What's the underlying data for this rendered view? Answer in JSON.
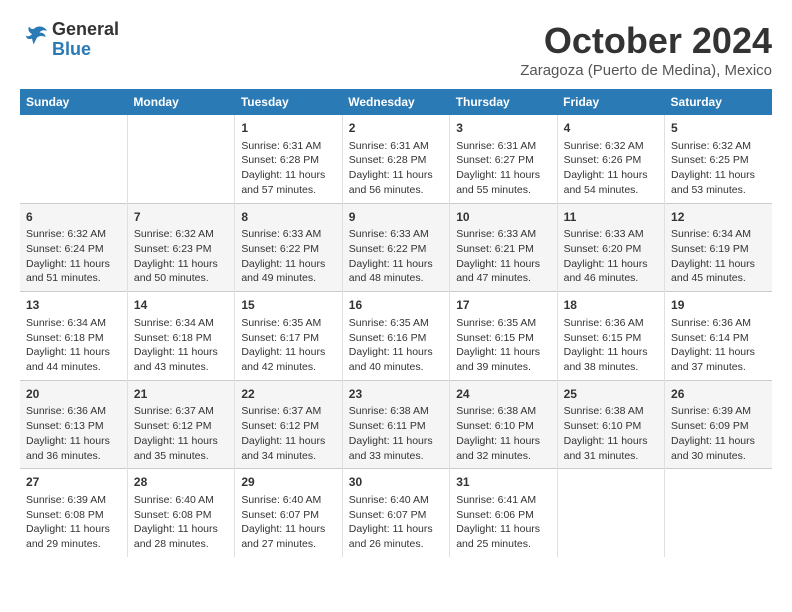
{
  "logo": {
    "line1": "General",
    "line2": "Blue"
  },
  "header": {
    "month_title": "October 2024",
    "location": "Zaragoza (Puerto de Medina), Mexico"
  },
  "days_of_week": [
    "Sunday",
    "Monday",
    "Tuesday",
    "Wednesday",
    "Thursday",
    "Friday",
    "Saturday"
  ],
  "weeks": [
    [
      {
        "day": "",
        "content": ""
      },
      {
        "day": "",
        "content": ""
      },
      {
        "day": "1",
        "content": "Sunrise: 6:31 AM\nSunset: 6:28 PM\nDaylight: 11 hours and 57 minutes."
      },
      {
        "day": "2",
        "content": "Sunrise: 6:31 AM\nSunset: 6:28 PM\nDaylight: 11 hours and 56 minutes."
      },
      {
        "day": "3",
        "content": "Sunrise: 6:31 AM\nSunset: 6:27 PM\nDaylight: 11 hours and 55 minutes."
      },
      {
        "day": "4",
        "content": "Sunrise: 6:32 AM\nSunset: 6:26 PM\nDaylight: 11 hours and 54 minutes."
      },
      {
        "day": "5",
        "content": "Sunrise: 6:32 AM\nSunset: 6:25 PM\nDaylight: 11 hours and 53 minutes."
      }
    ],
    [
      {
        "day": "6",
        "content": "Sunrise: 6:32 AM\nSunset: 6:24 PM\nDaylight: 11 hours and 51 minutes."
      },
      {
        "day": "7",
        "content": "Sunrise: 6:32 AM\nSunset: 6:23 PM\nDaylight: 11 hours and 50 minutes."
      },
      {
        "day": "8",
        "content": "Sunrise: 6:33 AM\nSunset: 6:22 PM\nDaylight: 11 hours and 49 minutes."
      },
      {
        "day": "9",
        "content": "Sunrise: 6:33 AM\nSunset: 6:22 PM\nDaylight: 11 hours and 48 minutes."
      },
      {
        "day": "10",
        "content": "Sunrise: 6:33 AM\nSunset: 6:21 PM\nDaylight: 11 hours and 47 minutes."
      },
      {
        "day": "11",
        "content": "Sunrise: 6:33 AM\nSunset: 6:20 PM\nDaylight: 11 hours and 46 minutes."
      },
      {
        "day": "12",
        "content": "Sunrise: 6:34 AM\nSunset: 6:19 PM\nDaylight: 11 hours and 45 minutes."
      }
    ],
    [
      {
        "day": "13",
        "content": "Sunrise: 6:34 AM\nSunset: 6:18 PM\nDaylight: 11 hours and 44 minutes."
      },
      {
        "day": "14",
        "content": "Sunrise: 6:34 AM\nSunset: 6:18 PM\nDaylight: 11 hours and 43 minutes."
      },
      {
        "day": "15",
        "content": "Sunrise: 6:35 AM\nSunset: 6:17 PM\nDaylight: 11 hours and 42 minutes."
      },
      {
        "day": "16",
        "content": "Sunrise: 6:35 AM\nSunset: 6:16 PM\nDaylight: 11 hours and 40 minutes."
      },
      {
        "day": "17",
        "content": "Sunrise: 6:35 AM\nSunset: 6:15 PM\nDaylight: 11 hours and 39 minutes."
      },
      {
        "day": "18",
        "content": "Sunrise: 6:36 AM\nSunset: 6:15 PM\nDaylight: 11 hours and 38 minutes."
      },
      {
        "day": "19",
        "content": "Sunrise: 6:36 AM\nSunset: 6:14 PM\nDaylight: 11 hours and 37 minutes."
      }
    ],
    [
      {
        "day": "20",
        "content": "Sunrise: 6:36 AM\nSunset: 6:13 PM\nDaylight: 11 hours and 36 minutes."
      },
      {
        "day": "21",
        "content": "Sunrise: 6:37 AM\nSunset: 6:12 PM\nDaylight: 11 hours and 35 minutes."
      },
      {
        "day": "22",
        "content": "Sunrise: 6:37 AM\nSunset: 6:12 PM\nDaylight: 11 hours and 34 minutes."
      },
      {
        "day": "23",
        "content": "Sunrise: 6:38 AM\nSunset: 6:11 PM\nDaylight: 11 hours and 33 minutes."
      },
      {
        "day": "24",
        "content": "Sunrise: 6:38 AM\nSunset: 6:10 PM\nDaylight: 11 hours and 32 minutes."
      },
      {
        "day": "25",
        "content": "Sunrise: 6:38 AM\nSunset: 6:10 PM\nDaylight: 11 hours and 31 minutes."
      },
      {
        "day": "26",
        "content": "Sunrise: 6:39 AM\nSunset: 6:09 PM\nDaylight: 11 hours and 30 minutes."
      }
    ],
    [
      {
        "day": "27",
        "content": "Sunrise: 6:39 AM\nSunset: 6:08 PM\nDaylight: 11 hours and 29 minutes."
      },
      {
        "day": "28",
        "content": "Sunrise: 6:40 AM\nSunset: 6:08 PM\nDaylight: 11 hours and 28 minutes."
      },
      {
        "day": "29",
        "content": "Sunrise: 6:40 AM\nSunset: 6:07 PM\nDaylight: 11 hours and 27 minutes."
      },
      {
        "day": "30",
        "content": "Sunrise: 6:40 AM\nSunset: 6:07 PM\nDaylight: 11 hours and 26 minutes."
      },
      {
        "day": "31",
        "content": "Sunrise: 6:41 AM\nSunset: 6:06 PM\nDaylight: 11 hours and 25 minutes."
      },
      {
        "day": "",
        "content": ""
      },
      {
        "day": "",
        "content": ""
      }
    ]
  ]
}
